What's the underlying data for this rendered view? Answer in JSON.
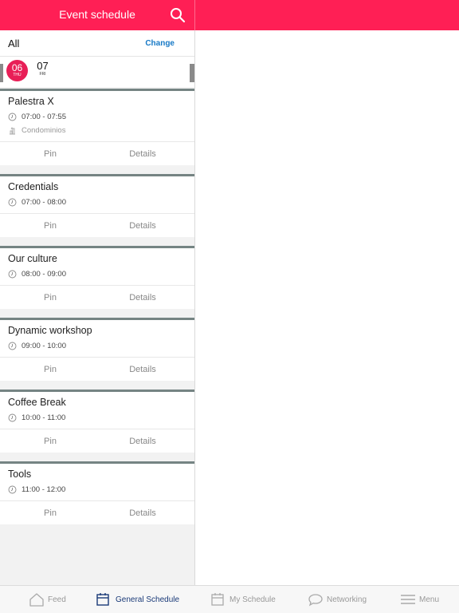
{
  "header": {
    "title": "Event schedule",
    "search_icon": "search-icon"
  },
  "filter": {
    "label": "All",
    "change_label": "Change"
  },
  "dates": [
    {
      "day": "06",
      "weekday": "THU",
      "selected": true
    },
    {
      "day": "07",
      "weekday": "FRI",
      "selected": false
    }
  ],
  "sessions": [
    {
      "title": "Palestra X",
      "time": "07:00 - 07:55",
      "venue": "Condominios",
      "pin": "Pin",
      "details": "Details"
    },
    {
      "title": "Credentials",
      "time": "07:00 - 08:00",
      "pin": "Pin",
      "details": "Details"
    },
    {
      "title": "Our culture",
      "time": "08:00 - 09:00",
      "pin": "Pin",
      "details": "Details"
    },
    {
      "title": "Dynamic workshop",
      "time": "09:00 - 10:00",
      "pin": "Pin",
      "details": "Details"
    },
    {
      "title": "Coffee Break",
      "time": "10:00 - 11:00",
      "pin": "Pin",
      "details": "Details"
    },
    {
      "title": "Tools",
      "time": "11:00 - 12:00",
      "pin": "Pin",
      "details": "Details"
    }
  ],
  "tabs": [
    {
      "label": "Feed",
      "icon": "home-icon",
      "active": false
    },
    {
      "label": "General Schedule",
      "icon": "calendar-icon",
      "active": true
    },
    {
      "label": "My Schedule",
      "icon": "calendar-icon",
      "active": false
    },
    {
      "label": "Networking",
      "icon": "chat-bubble-icon",
      "active": false
    },
    {
      "label": "Menu",
      "icon": "hamburger-menu-icon",
      "active": false
    }
  ],
  "colors": {
    "brand": "#ff1f55",
    "selected_date": "#e81f57",
    "card_top_border": "#758483",
    "link": "#1779c6",
    "active_tab": "#1a3a78"
  }
}
